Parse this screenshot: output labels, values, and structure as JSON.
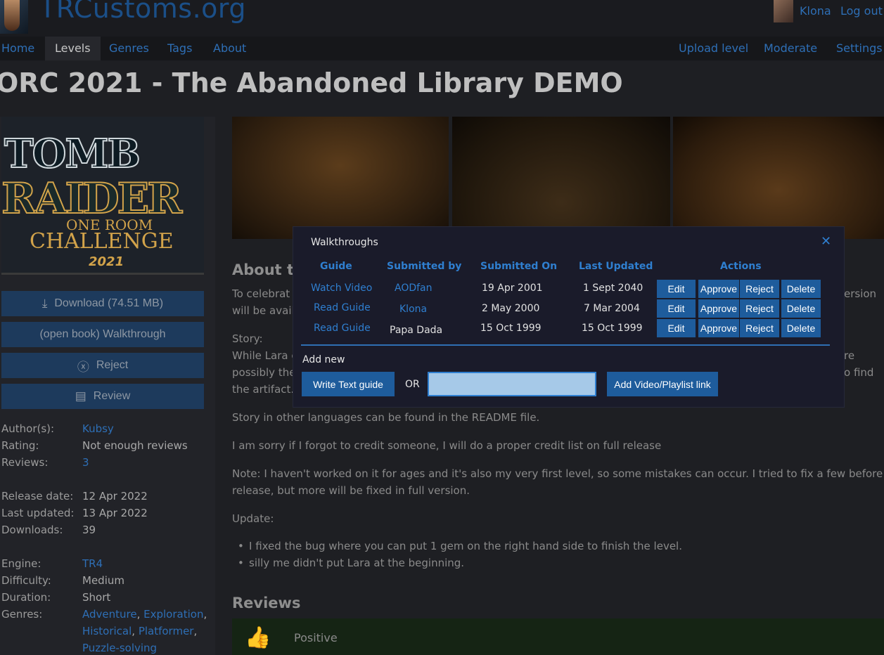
{
  "header": {
    "logo_text": "TRCustoms.org",
    "user_name": "Klona",
    "logout_label": "Log out"
  },
  "nav": {
    "left": [
      "Home",
      "Levels",
      "Genres",
      "Tags",
      "About"
    ],
    "active": "Levels",
    "right": [
      "Upload level",
      "Moderate",
      "Settings"
    ]
  },
  "level": {
    "title": "ORC 2021 - The Abandoned Library DEMO"
  },
  "cover": {
    "line1": "TOMB",
    "line2": "RAIDER",
    "line3": "ONE ROOM",
    "line4": "CHALLENGE",
    "line5": "2021"
  },
  "sidebar": {
    "download_label": "Download (74.51 MB)",
    "walkthrough_label": "(open book) Walkthrough",
    "reject_label": "Reject",
    "review_label": "Review",
    "author_label": "Author(s):",
    "author": "Kubsy",
    "rating_label": "Rating:",
    "rating": "Not enough reviews",
    "reviews_label": "Reviews:",
    "reviews": "3",
    "release_label": "Release date:",
    "release": "12 Apr 2022",
    "updated_label": "Last updated:",
    "updated": "13 Apr 2022",
    "downloads_label": "Downloads:",
    "downloads": "39",
    "engine_label": "Engine:",
    "engine": "TR4",
    "difficulty_label": "Difficulty:",
    "difficulty": "Medium",
    "duration_label": "Duration:",
    "duration": "Short",
    "genres_label": "Genres:",
    "genres": [
      "Adventure",
      "Exploration",
      "Historical",
      "Platformer",
      "Puzzle-solving"
    ]
  },
  "about": {
    "heading": "About th",
    "p1a": "To celebrat",
    "p1b": "will be avail",
    "p1end": "ersion",
    "story_label": "Story:",
    "story1": "While Lara c",
    "story1_end": "re",
    "story2": "possibly the",
    "story2_end": "o find",
    "story3": "the artifact.",
    "p_lang": "Story in other languages can be found in the README file.",
    "p_credit": "I am sorry if I forgot to credit someone, I will do a proper credit list on full release",
    "p_note1": "Note: I haven't worked on it for ages and it's also my very first level, so some mistakes can occur. I tried to fix a few before",
    "p_note2": "release, but more will be fixed in full version.",
    "update_label": "Update:",
    "bullets": [
      "I fixed the bug where you can put 1 gem on the right hand side to finish the level.",
      "silly me didn't put Lara at the beginning."
    ]
  },
  "reviews": {
    "heading": "Reviews",
    "first_label": "Positive"
  },
  "modal": {
    "title": "Walkthroughs",
    "columns": [
      "Guide",
      "Submitted by",
      "Submitted On",
      "Last Updated",
      "Actions"
    ],
    "rows": [
      {
        "guide": "Watch Video",
        "by": "AODfan",
        "on": "19 Apr 2001",
        "updated": "1 Sept 2040"
      },
      {
        "guide": "Read Guide",
        "by": "Klona",
        "on": "2 May 2000",
        "updated": "7 Mar 2004"
      },
      {
        "guide": "Read Guide",
        "by": "Papa Dada",
        "on": "15 Oct 1999",
        "updated": "15 Oct 1999"
      }
    ],
    "actions": {
      "edit": "Edit",
      "approve": "Approve",
      "reject": "Reject",
      "delete": "Delete"
    },
    "add_new_label": "Add new",
    "write_text_label": "Write Text guide",
    "or_label": "OR",
    "link_value": "",
    "add_video_label": "Add Video/Playlist link"
  }
}
